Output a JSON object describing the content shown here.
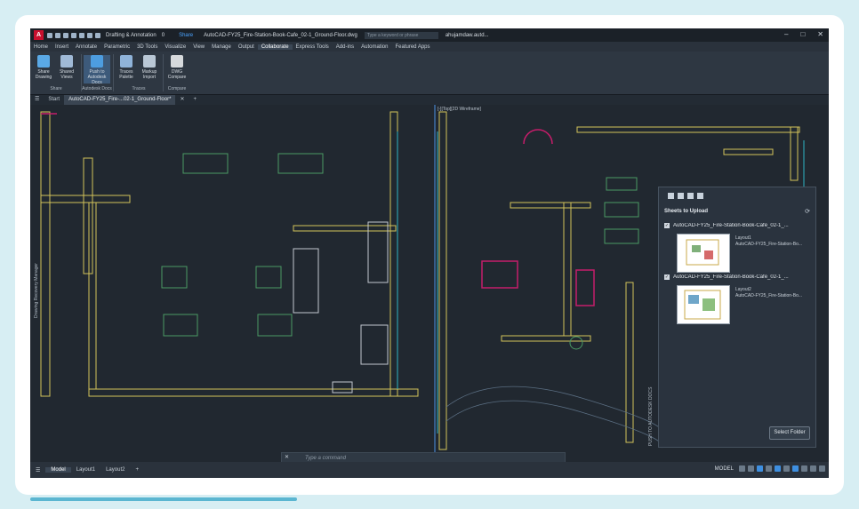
{
  "title_bar": {
    "logo": "A",
    "workspace": "Drafting & Annotation",
    "layer": "0",
    "share_label": "Share",
    "doc_title": "AutoCAD-FY25_Fire-Station-Book-Cafe_02-1_Ground-Floor.dwg",
    "search_placeholder": "Type a keyword or phrase",
    "user": "ahujamdaw.autd..."
  },
  "menu": {
    "tabs": [
      "Home",
      "Insert",
      "Annotate",
      "Parametric",
      "3D Tools",
      "Visualize",
      "View",
      "Manage",
      "Output",
      "Collaborate",
      "Express Tools",
      "Add-ins",
      "Automation",
      "Featured Apps"
    ],
    "active": "Collaborate"
  },
  "ribbon": {
    "buttons": [
      {
        "label1": "Share",
        "label2": "Drawing",
        "color": "#5aa9e6"
      },
      {
        "label1": "Shared",
        "label2": "Views",
        "color": "#9fb9d6"
      },
      {
        "label1": "Push to",
        "label2": "Autodesk Docs",
        "color": "#4d9de0"
      },
      {
        "label1": "Traces",
        "label2": "Palette",
        "color": "#8fb3d9"
      },
      {
        "label1": "Markup",
        "label2": "Import",
        "color": "#b9c7d5"
      },
      {
        "label1": "DWG",
        "label2": "Compare",
        "color": "#d6d9dc"
      }
    ],
    "groups": [
      "Share",
      "Autodesk Docs",
      "Traces",
      "Compare"
    ]
  },
  "doc_tabs": {
    "start": "Start",
    "current": "AutoCAD-FY25_Fire-...02-1_Ground-Floor*"
  },
  "viewport": {
    "label": "[-][Top][2D Wireframe]"
  },
  "left_palette": "Drawing Recovery Manager",
  "right_palette": "PUSH TO AUTODESK DOCS",
  "panel": {
    "header": "Sheets to Upload",
    "sheets": [
      {
        "name": "AutoCAD-FY25_Fire-Station-Book-Cafe_02-1_...",
        "layout": "Layout1",
        "file": "AutoCAD-FY25_Fire-Station-Bo..."
      },
      {
        "name": "AutoCAD-FY25_Fire-Station-Book-Cafe_02-1_...",
        "layout": "Layout2",
        "file": "AutoCAD-FY25_Fire-Station-Bo..."
      }
    ],
    "select_folder": "Select Folder"
  },
  "command": {
    "placeholder": "Type a command"
  },
  "status": {
    "layouts": [
      "Model",
      "Layout1",
      "Layout2"
    ],
    "model_label": "MODEL"
  }
}
